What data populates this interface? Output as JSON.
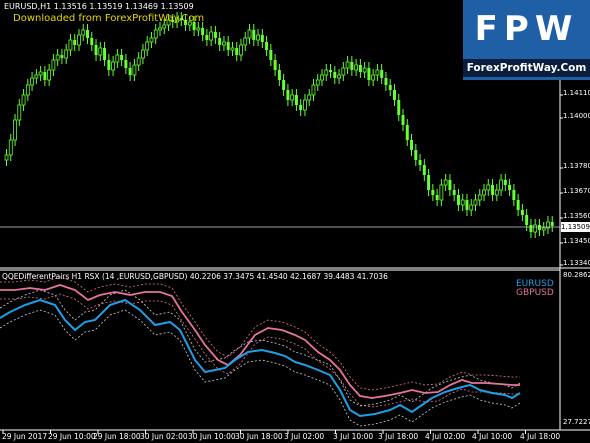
{
  "header": {
    "symbol_info": "EURUSD,H1  1.13516 1.13519 1.13469 1.13509",
    "download_note": "Downloaded from ForexProfitWay.Com"
  },
  "logo": {
    "letters": "FPW",
    "site": "ForexProfitWay.Com"
  },
  "price_axis": {
    "labels": [
      "1.14110",
      "1.14000",
      "1.13780",
      "1.13670",
      "1.13560",
      "1.13450",
      "1.13340"
    ],
    "current_price": "1.13509"
  },
  "indicator": {
    "info": "QQEDifferentPairs H1 RSX (14 ,EURUSD,GBPUSD)  40.2206 37.3475 41.4540 42.1687 39.4483 41.7036",
    "axis_top": "80.2862",
    "axis_bottom": "27.7227",
    "legend": [
      {
        "name": "EURUSD",
        "color": "#1ea0e6"
      },
      {
        "name": "GBPUSD",
        "color": "#e8749e"
      }
    ]
  },
  "time_axis": {
    "labels": [
      "29 Jun 2017",
      "29 Jun 10:00",
      "29 Jun 18:00",
      "30 Jun 02:00",
      "30 Jun 10:00",
      "30 Jun 18:00",
      "3 Jul 02:00",
      "3 Jul 10:00",
      "3 Jul 18:00",
      "4 Jul 02:00",
      "4 Jul 10:00",
      "4 Jul 18:00"
    ]
  },
  "colors": {
    "background": "#000000",
    "candles": "#66ff33",
    "eurusd": "#1ea0e6",
    "gbpusd": "#e8749e",
    "grid": "#ffffff"
  }
}
